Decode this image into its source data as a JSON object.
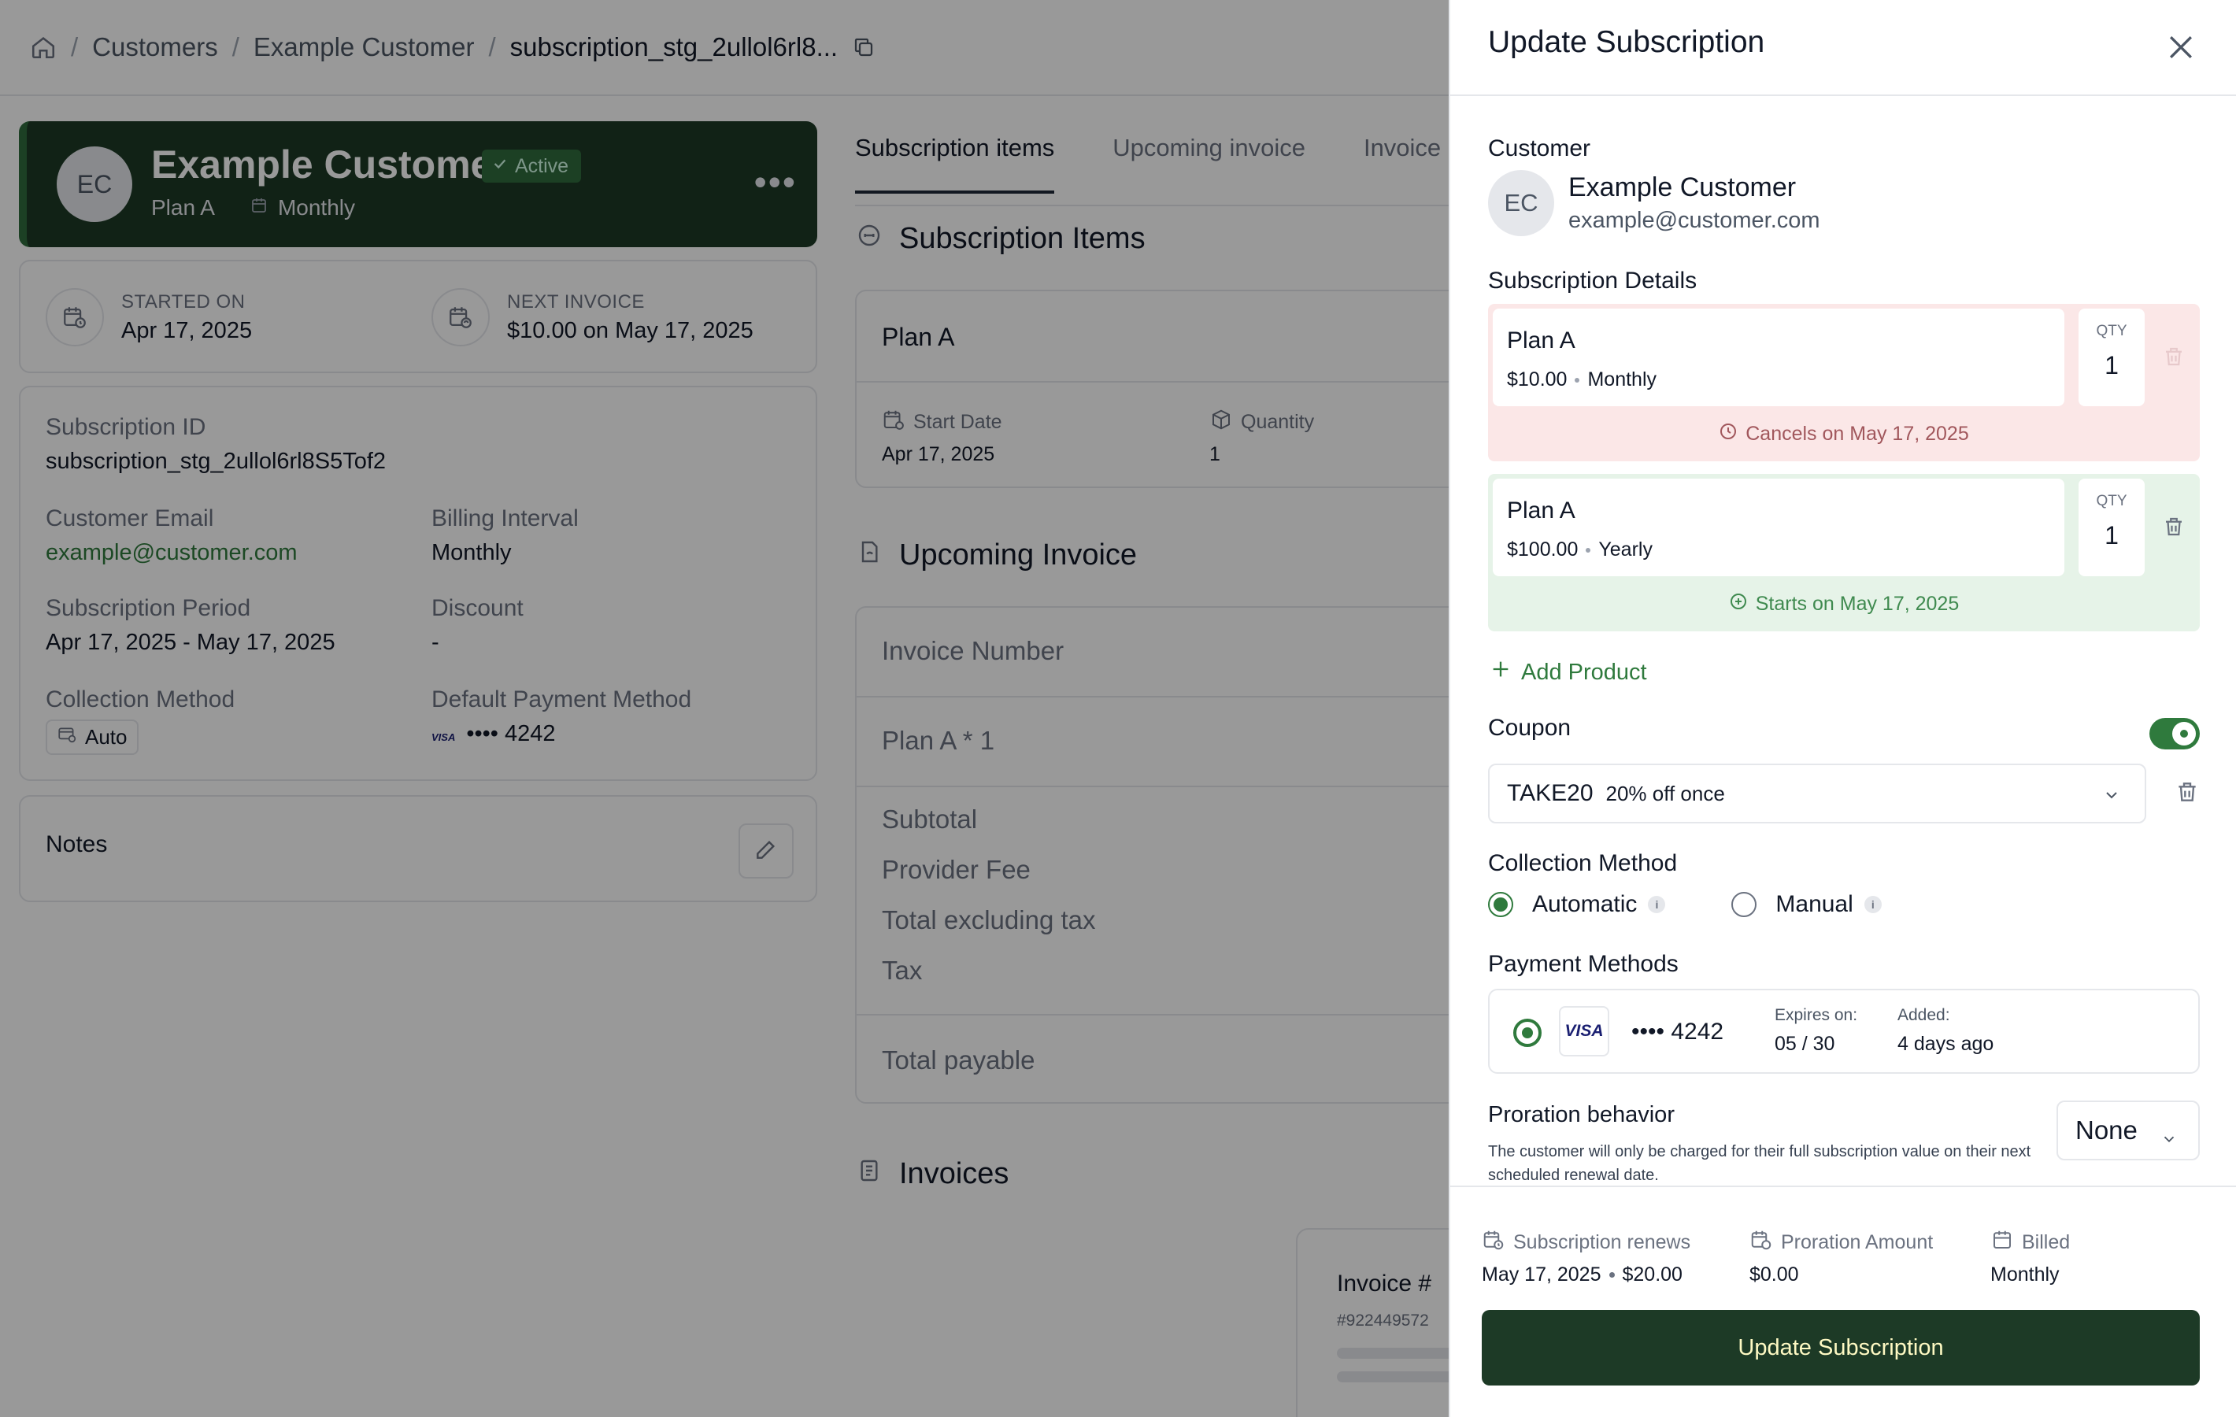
{
  "breadcrumb": {
    "items": [
      "Customers",
      "Example Customer"
    ],
    "current": "subscription_stg_2ullol6rl8..."
  },
  "customer_card": {
    "initials": "EC",
    "name": "Example Customer",
    "status": "Active",
    "plan": "Plan A",
    "interval": "Monthly"
  },
  "dates": {
    "started_label": "STARTED ON",
    "started_value": "Apr 17, 2025",
    "next_label": "NEXT INVOICE",
    "next_value": "$10.00 on May 17, 2025"
  },
  "details": {
    "sub_id_label": "Subscription ID",
    "sub_id_value": "subscription_stg_2ullol6rl8S5Tof2",
    "email_label": "Customer Email",
    "email_value": "example@customer.com",
    "billing_label": "Billing Interval",
    "billing_value": "Monthly",
    "period_label": "Subscription Period",
    "period_value": "Apr 17, 2025 - May 17, 2025",
    "discount_label": "Discount",
    "discount_value": "-",
    "collection_label": "Collection Method",
    "collection_value": "Auto",
    "payment_label": "Default Payment Method",
    "payment_brand": "VISA",
    "payment_value": "•••• 4242"
  },
  "notes": {
    "label": "Notes"
  },
  "tabs": [
    "Subscription items",
    "Upcoming invoice",
    "Invoice"
  ],
  "items_section": {
    "title": "Subscription Items",
    "plan": "Plan A",
    "start_label": "Start Date",
    "start_value": "Apr 17, 2025",
    "qty_label": "Quantity",
    "qty_value": "1"
  },
  "upcoming_section": {
    "title": "Upcoming Invoice",
    "rows": [
      "Invoice Number",
      "Plan A * 1",
      "Subtotal",
      "Provider Fee",
      "Total excluding tax",
      "Tax",
      "Total payable"
    ]
  },
  "invoices_section": {
    "title": "Invoices",
    "card_title": "Invoice #",
    "card_number": "#922449572"
  },
  "drawer": {
    "title": "Update Subscription",
    "customer_label": "Customer",
    "customer_initials": "EC",
    "customer_name": "Example Customer",
    "customer_email": "example@customer.com",
    "details_label": "Subscription Details",
    "plans": [
      {
        "name": "Plan A",
        "price": "$10.00",
        "interval": "Monthly",
        "qty_label": "QTY",
        "qty": "1",
        "note": "Cancels on May 17, 2025"
      },
      {
        "name": "Plan A",
        "price": "$100.00",
        "interval": "Yearly",
        "qty_label": "QTY",
        "qty": "1",
        "note": "Starts on May 17, 2025"
      }
    ],
    "add_product": "Add Product",
    "coupon_label": "Coupon",
    "coupon_code": "TAKE20",
    "coupon_desc": "20% off once",
    "collection_label": "Collection Method",
    "collection_options": [
      "Automatic",
      "Manual"
    ],
    "payment_label": "Payment Methods",
    "payment_brand": "VISA",
    "payment_number": "•••• 4242",
    "expires_label": "Expires on:",
    "expires_value": "05 / 30",
    "added_label": "Added:",
    "added_value": "4 days ago",
    "proration_label": "Proration behavior",
    "proration_desc": "The customer will only be charged for their full subscription value on their next scheduled renewal date.",
    "proration_value": "None",
    "summary": {
      "renews_label": "Subscription renews",
      "renews_date": "May 17, 2025",
      "renews_amount": "$20.00",
      "proration_label": "Proration Amount",
      "proration_value": "$0.00",
      "billed_label": "Billed",
      "billed_value": "Monthly"
    },
    "submit": "Update Subscription"
  },
  "colors": {
    "brand_dark": "#1d3a26",
    "accent_green": "#2f7a3d",
    "cancel_bg": "#fbe7e7",
    "start_bg": "#e6f3e8"
  }
}
